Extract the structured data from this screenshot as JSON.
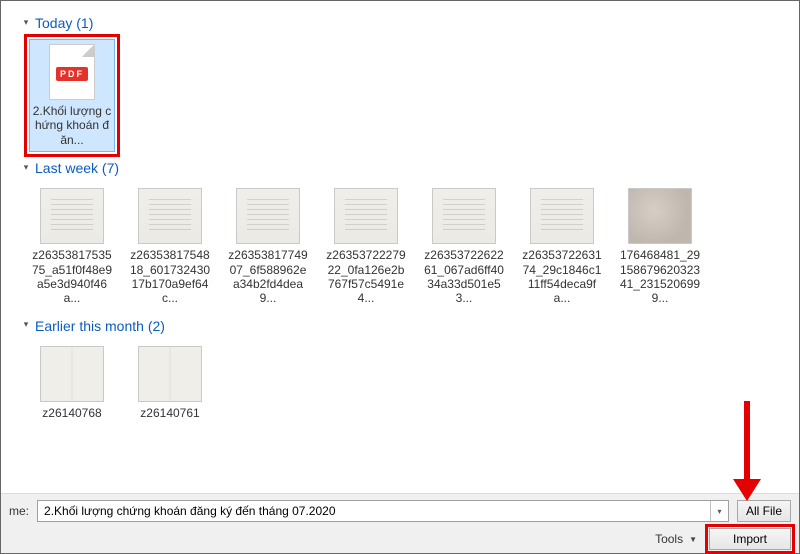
{
  "groups": [
    {
      "label": "Today",
      "count": "1"
    },
    {
      "label": "Last week",
      "count": "7"
    },
    {
      "label": "Earlier this month",
      "count": "2"
    }
  ],
  "pdf_badge": "PDF",
  "today_file": {
    "name": "2.Khối lượng chứng khoán đăn..."
  },
  "lastweek_files": [
    {
      "name": "z2635381753575_a51f0f48e9a5e3d940f46a..."
    },
    {
      "name": "z2635381754818_60173243017b170a9ef64c..."
    },
    {
      "name": "z2635381774907_6f588962ea34b2fd4dea9..."
    },
    {
      "name": "z2635372227922_0fa126e2b767f57c5491e4..."
    },
    {
      "name": "z2635372262261_067ad6ff4034a33d501e53..."
    },
    {
      "name": "z2635372263174_29c1846c111ff54deca9fa..."
    },
    {
      "name": "176468481_2915867962032341_2315206999..."
    }
  ],
  "earlier_files": [
    {
      "name": "z26140768"
    },
    {
      "name": "z26140761"
    }
  ],
  "filename_label": "me:",
  "filename_value": "2.Khối lượng chứng khoán đăng ký đến tháng 07.2020",
  "filter_label": "All File",
  "tools_label": "Tools",
  "import_label": "Import"
}
